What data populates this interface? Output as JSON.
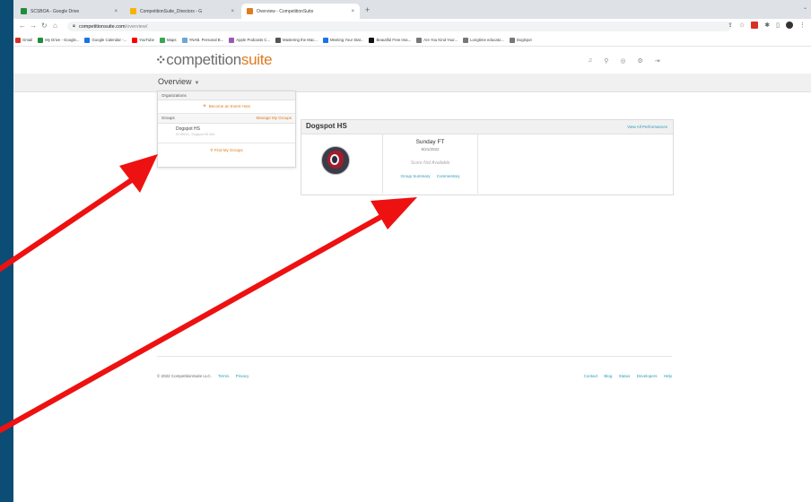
{
  "browser": {
    "tabs": [
      {
        "label": "SCSBOA - Google Drive",
        "active": false,
        "color": "#1e8e3e"
      },
      {
        "label": "CompetitionSuite_Directors - G",
        "active": false,
        "color": "#f4b400"
      },
      {
        "label": "Overview - CompetitionSuite",
        "active": true,
        "color": "#e07b1f"
      }
    ],
    "url_domain": "competitionsuite.com",
    "url_path": "/overview/",
    "bookmarks": [
      {
        "label": "Gmail",
        "color": "#d93025"
      },
      {
        "label": "My Drive - Google...",
        "color": "#1e8e3e"
      },
      {
        "label": "Google Calendar -...",
        "color": "#1a73e8"
      },
      {
        "label": "YouTube",
        "color": "#ff0000"
      },
      {
        "label": "Maps",
        "color": "#34a853"
      },
      {
        "label": "YNAB. Personal B...",
        "color": "#6aa6d8"
      },
      {
        "label": "Apple Podcasts C...",
        "color": "#9b59b6"
      },
      {
        "label": "Mastering the Mac...",
        "color": "#555555"
      },
      {
        "label": "Meeting Your Stat...",
        "color": "#1a73e8"
      },
      {
        "label": "Beautiful Free Ima...",
        "color": "#111111"
      },
      {
        "label": "Are You Kind Your...",
        "color": "#777777"
      },
      {
        "label": "Longtime educato...",
        "color": "#777777"
      },
      {
        "label": "DogSpot",
        "color": "#777777"
      }
    ]
  },
  "site": {
    "logo_main": "competition",
    "logo_accent": "suite",
    "nav_label": "Overview"
  },
  "dropdown": {
    "organizations_header": "Organizations",
    "become_host": "Become an Event Host",
    "groups_header": "Groups",
    "manage_groups": "Manage My Groups",
    "group_name": "Dogspot HS",
    "group_sub": "SCSBOA - Dogspot HS M&I",
    "find_groups": "Find My Groups"
  },
  "card": {
    "title": "Dogspot HS",
    "view_all": "View All Performances",
    "performance": {
      "name": "Sunday FT",
      "date": "8/21/2022",
      "score": "Score Not Available",
      "link_summary": "Group Summary",
      "link_commentary": "Commentary"
    }
  },
  "footer": {
    "copyright": "© 2022 CompetitionSuite LLC.",
    "terms": "Terms",
    "privacy": "Privacy",
    "links": [
      "Contact",
      "Blog",
      "Status",
      "Developers",
      "Help"
    ]
  },
  "colors": {
    "accent": "#e07b1f",
    "link": "#2b9bb5",
    "annotation_arrow": "#ee1111",
    "backdrop": "#0b4d74"
  }
}
